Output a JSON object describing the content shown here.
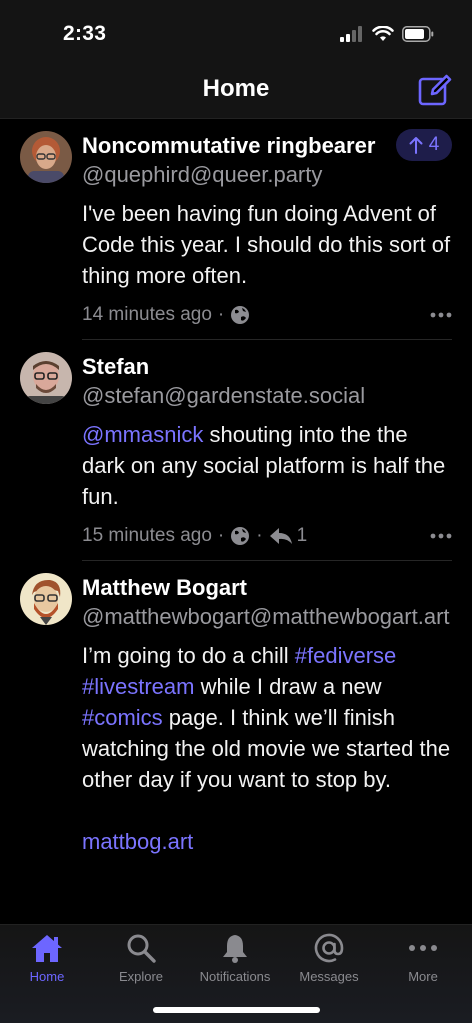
{
  "status_bar": {
    "time": "2:33"
  },
  "nav": {
    "title": "Home"
  },
  "new_posts_badge": {
    "count": "4"
  },
  "posts": [
    {
      "name": "Noncommutative ringbearer",
      "handle": "@quephird@queer.party",
      "body": [
        {
          "text": "I've been having fun doing Advent of Code this year. I should do this sort of thing more often.",
          "link": false
        }
      ],
      "time": "14 minutes ago",
      "replies": ""
    },
    {
      "name": "Stefan",
      "handle": "@stefan@gardenstate.social",
      "body": [
        {
          "text": "@mmasnick",
          "link": true
        },
        {
          "text": " shouting into the the dark on any social platform is half the fun.",
          "link": false
        }
      ],
      "time": "15 minutes ago",
      "replies": "1"
    },
    {
      "name": "Matthew Bogart",
      "handle": "@matthewbogart@matthewbogart.art",
      "body": [
        {
          "text": "I’m going to do a chill ",
          "link": false
        },
        {
          "text": "#fediverse",
          "link": true
        },
        {
          "text": " ",
          "link": false
        },
        {
          "text": "#livestream",
          "link": true
        },
        {
          "text": " while I draw a new ",
          "link": false
        },
        {
          "text": "#comics",
          "link": true
        },
        {
          "text": " page. I think we’ll finish watching the old movie we started the other day if you want to stop by.",
          "link": false
        }
      ],
      "link_line": "mattbog.art",
      "time": "",
      "replies": ""
    }
  ],
  "tabs": [
    {
      "label": "Home",
      "icon": "home-icon",
      "active": true
    },
    {
      "label": "Explore",
      "icon": "search-icon",
      "active": false
    },
    {
      "label": "Notifications",
      "icon": "bell-icon",
      "active": false
    },
    {
      "label": "Messages",
      "icon": "at-icon",
      "active": false
    },
    {
      "label": "More",
      "icon": "ellipsis-icon",
      "active": false
    }
  ],
  "colors": {
    "accent": "#6d66ff",
    "link": "#7b74ff",
    "background": "#000000",
    "secondary_text": "#9a9a9f"
  }
}
